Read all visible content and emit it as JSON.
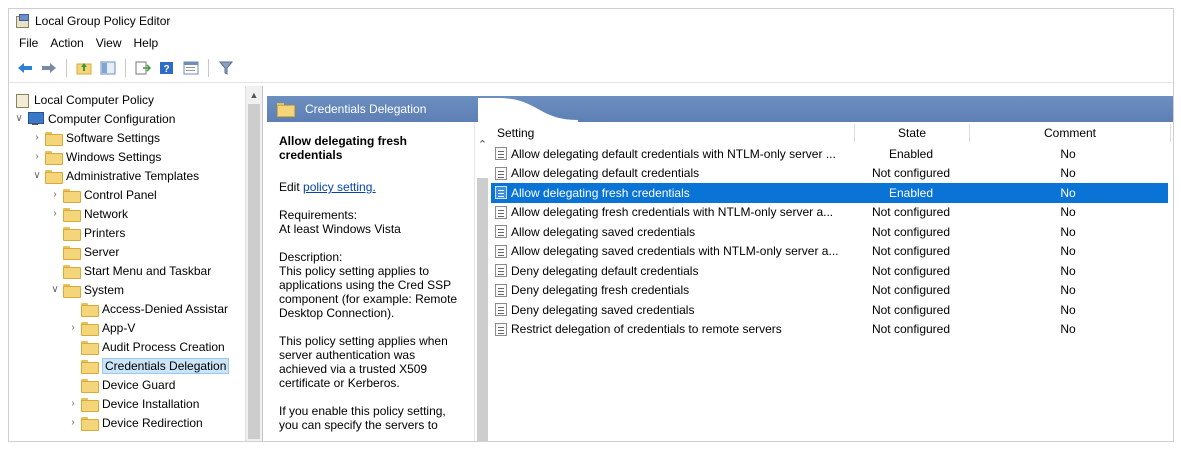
{
  "window": {
    "title": "Local Group Policy Editor"
  },
  "menu": [
    "File",
    "Action",
    "View",
    "Help"
  ],
  "toolbar": [
    "back-icon",
    "forward-icon",
    "up-folder-icon",
    "show-hide-tree-icon",
    "export-list-icon",
    "help-icon",
    "properties-icon",
    "filter-icon"
  ],
  "tree": {
    "root": "Local Computer Policy",
    "computer_config": "Computer Configuration",
    "software_settings": "Software Settings",
    "windows_settings": "Windows Settings",
    "admin_templates": "Administrative Templates",
    "control_panel": "Control Panel",
    "network": "Network",
    "printers": "Printers",
    "server": "Server",
    "start_menu": "Start Menu and Taskbar",
    "system": "System",
    "access_denied": "Access-Denied Assistar",
    "app_v": "App-V",
    "audit_process": "Audit Process Creation",
    "credentials_delegation": "Credentials Delegation",
    "device_guard": "Device Guard",
    "device_installation": "Device Installation",
    "device_redirection": "Device Redirection"
  },
  "header": {
    "title": "Credentials Delegation"
  },
  "description": {
    "title": "Allow delegating fresh credentials",
    "edit_prefix": "Edit",
    "edit_link": "policy setting.",
    "requirements_label": "Requirements:",
    "requirements_value": "At least Windows Vista",
    "description_label": "Description:",
    "para1": "This policy setting applies to applications using the Cred SSP component (for example: Remote Desktop Connection).",
    "para2": "This policy setting applies when server authentication was achieved via a trusted X509 certificate or Kerberos.",
    "para3": "If you enable this policy setting, you can specify the servers to"
  },
  "list": {
    "columns": {
      "setting": "Setting",
      "state": "State",
      "comment": "Comment"
    },
    "rows": [
      {
        "setting": "Allow delegating default credentials with NTLM-only server ...",
        "state": "Enabled",
        "comment": "No"
      },
      {
        "setting": "Allow delegating default credentials",
        "state": "Not configured",
        "comment": "No"
      },
      {
        "setting": "Allow delegating fresh credentials",
        "state": "Enabled",
        "comment": "No"
      },
      {
        "setting": "Allow delegating fresh credentials with NTLM-only server a...",
        "state": "Not configured",
        "comment": "No"
      },
      {
        "setting": "Allow delegating saved credentials",
        "state": "Not configured",
        "comment": "No"
      },
      {
        "setting": "Allow delegating saved credentials with NTLM-only server a...",
        "state": "Not configured",
        "comment": "No"
      },
      {
        "setting": "Deny delegating default credentials",
        "state": "Not configured",
        "comment": "No"
      },
      {
        "setting": "Deny delegating fresh credentials",
        "state": "Not configured",
        "comment": "No"
      },
      {
        "setting": "Deny delegating saved credentials",
        "state": "Not configured",
        "comment": "No"
      },
      {
        "setting": "Restrict delegation of credentials to remote servers",
        "state": "Not configured",
        "comment": "No"
      }
    ]
  },
  "colors": {
    "selection": "#0a74d6",
    "header_band": "#6c8fc0",
    "tree_selection": "#cce4f7"
  }
}
